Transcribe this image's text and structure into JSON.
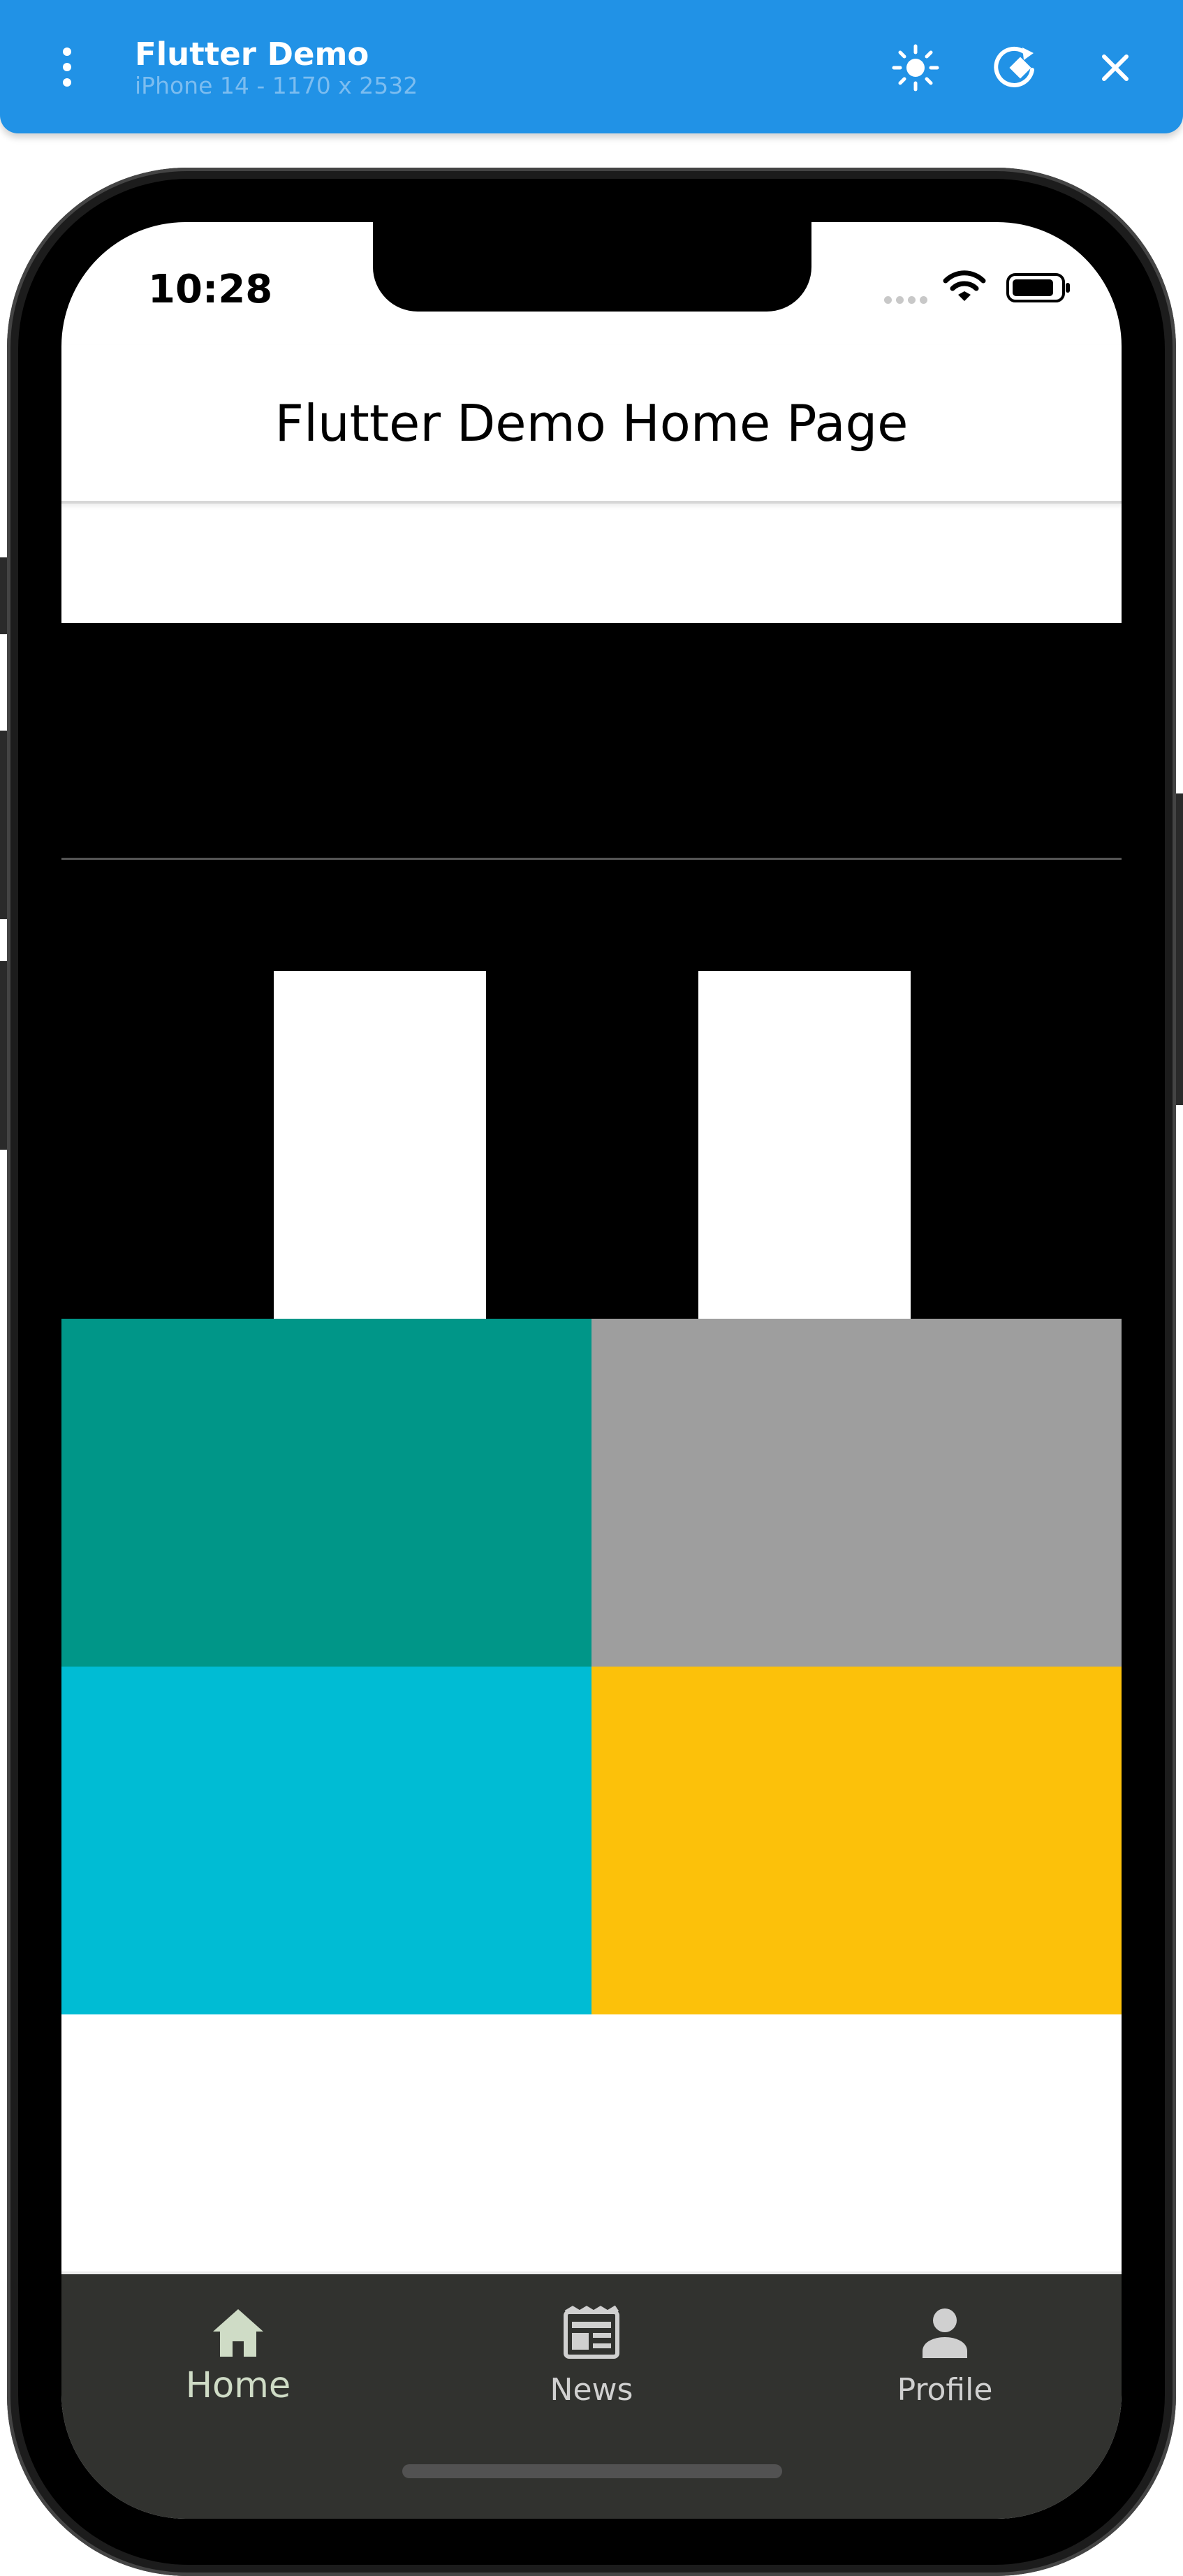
{
  "window": {
    "title": "Flutter Demo",
    "subtitle": "iPhone 14 - 1170 x 2532",
    "menu_icon": "more-vert-icon",
    "theme_icon": "sun-icon",
    "rotate_icon": "rotate-device-icon",
    "close_icon": "close-icon"
  },
  "status_bar": {
    "time": "10:28",
    "wifi_icon": "wifi-icon",
    "battery_icon": "battery-icon"
  },
  "app_bar": {
    "title": "Flutter Demo Home Page"
  },
  "body": {
    "tiles": {
      "teal": "#009688",
      "grey": "#9e9e9e",
      "cyan": "#00bcd4",
      "amber": "#fcc10a"
    },
    "stripe_colors": [
      "#000000",
      "#ffffff",
      "#000000",
      "#ffffff",
      "#000000"
    ]
  },
  "bottom_nav": {
    "background": "#31322f",
    "items": [
      {
        "label": "Home",
        "icon": "home-icon",
        "selected": true,
        "color": "#cfdcc6"
      },
      {
        "label": "News",
        "icon": "newspaper-icon",
        "selected": false,
        "color": "#d0d0d0"
      },
      {
        "label": "Profile",
        "icon": "person-icon",
        "selected": false,
        "color": "#d0d0d0"
      }
    ]
  }
}
